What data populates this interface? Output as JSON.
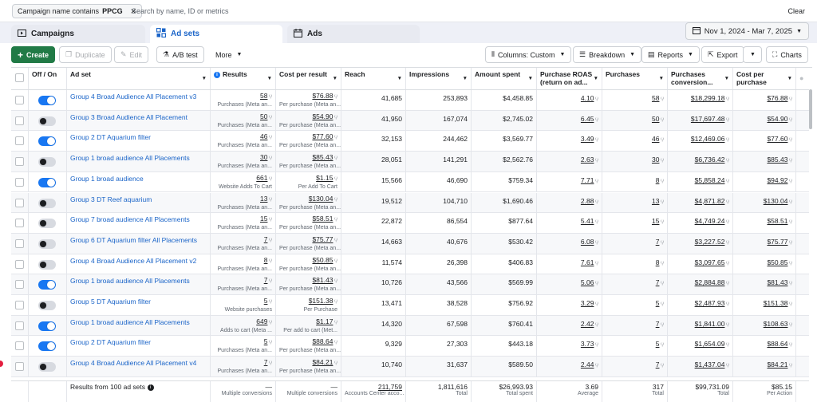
{
  "filter": {
    "chip_prefix": "Campaign name contains",
    "chip_value": "PPCG",
    "search_placeholder": "Search by name, ID or metrics",
    "clear_label": "Clear"
  },
  "tabs": [
    {
      "label": "Campaigns"
    },
    {
      "label": "Ad sets"
    },
    {
      "label": "Ads"
    }
  ],
  "date_range": "Nov 1, 2024 - Mar 7, 2025",
  "toolbar": {
    "create": "Create",
    "duplicate": "Duplicate",
    "edit": "Edit",
    "ab_test": "A/B test",
    "more": "More",
    "columns": "Columns: Custom",
    "breakdown": "Breakdown",
    "reports": "Reports",
    "export": "Export",
    "charts": "Charts"
  },
  "headers": {
    "off_on": "Off / On",
    "ad_set": "Ad set",
    "results": "Results",
    "cost_per_result": "Cost per result",
    "reach": "Reach",
    "impressions": "Impressions",
    "amount_spent": "Amount spent",
    "purchase_roas": "Purchase ROAS (return on ad...",
    "purchases": "Purchases",
    "purchases_conv": "Purchases conversion...",
    "cost_per_purchase": "Cost per purchase"
  },
  "rows": [
    {
      "on": true,
      "name": "Group 4 Broad Audience All Placement v3",
      "results": "58",
      "results_sub": "Purchases (Meta an...",
      "cpr": "$76.88",
      "cpr_sub": "Per purchase (Meta an...",
      "reach": "41,685",
      "impressions": "253,893",
      "amount": "$4,458.85",
      "roas": "4.10",
      "purchases": "58",
      "conv": "$18,299.18",
      "cpp": "$76.88"
    },
    {
      "on": false,
      "name": "Group 3 Broad Audience All Placement",
      "results": "50",
      "results_sub": "Purchases (Meta an...",
      "cpr": "$54.90",
      "cpr_sub": "Per purchase (Meta an...",
      "reach": "41,950",
      "impressions": "167,074",
      "amount": "$2,745.02",
      "roas": "6.45",
      "purchases": "50",
      "conv": "$17,697.48",
      "cpp": "$54.90"
    },
    {
      "on": true,
      "name": "Group 2 DT Aquarium filter",
      "results": "46",
      "results_sub": "Purchases (Meta an...",
      "cpr": "$77.60",
      "cpr_sub": "Per purchase (Meta an...",
      "reach": "32,153",
      "impressions": "244,462",
      "amount": "$3,569.77",
      "roas": "3.49",
      "purchases": "46",
      "conv": "$12,469.06",
      "cpp": "$77.60"
    },
    {
      "on": false,
      "name": "Group 1 broad audience All Placements",
      "results": "30",
      "results_sub": "Purchases (Meta an...",
      "cpr": "$85.43",
      "cpr_sub": "Per purchase (Meta an...",
      "reach": "28,051",
      "impressions": "141,291",
      "amount": "$2,562.76",
      "roas": "2.63",
      "purchases": "30",
      "conv": "$6,736.42",
      "cpp": "$85.43"
    },
    {
      "on": true,
      "name": "Group 1 broad audience",
      "results": "661",
      "results_sub": "Website Adds To Cart",
      "cpr": "$1.15",
      "cpr_sub": "Per Add To Cart",
      "reach": "15,566",
      "impressions": "46,690",
      "amount": "$759.34",
      "roas": "7.71",
      "purchases": "8",
      "conv": "$5,858.24",
      "cpp": "$94.92"
    },
    {
      "on": false,
      "name": "Group 3 DT Reef aquarium",
      "results": "13",
      "results_sub": "Purchases (Meta an...",
      "cpr": "$130.04",
      "cpr_sub": "Per purchase (Meta an...",
      "reach": "19,512",
      "impressions": "104,710",
      "amount": "$1,690.46",
      "roas": "2.88",
      "purchases": "13",
      "conv": "$4,871.82",
      "cpp": "$130.04"
    },
    {
      "on": false,
      "name": "Group 7 broad audience All Placements",
      "results": "15",
      "results_sub": "Purchases (Meta an...",
      "cpr": "$58.51",
      "cpr_sub": "Per purchase (Meta an...",
      "reach": "22,872",
      "impressions": "86,554",
      "amount": "$877.64",
      "roas": "5.41",
      "purchases": "15",
      "conv": "$4,749.24",
      "cpp": "$58.51"
    },
    {
      "on": false,
      "name": "Group 6 DT Aquarium filter All Placements",
      "results": "7",
      "results_sub": "Purchases (Meta an...",
      "cpr": "$75.77",
      "cpr_sub": "Per purchase (Meta an...",
      "reach": "14,663",
      "impressions": "40,676",
      "amount": "$530.42",
      "roas": "6.08",
      "purchases": "7",
      "conv": "$3,227.52",
      "cpp": "$75.77"
    },
    {
      "on": false,
      "name": "Group 4 Broad Audience All Placement v2",
      "results": "8",
      "results_sub": "Purchases (Meta an...",
      "cpr": "$50.85",
      "cpr_sub": "Per purchase (Meta an...",
      "reach": "11,574",
      "impressions": "26,398",
      "amount": "$406.83",
      "roas": "7.61",
      "purchases": "8",
      "conv": "$3,097.65",
      "cpp": "$50.85"
    },
    {
      "on": true,
      "name": "Group 1 broad audience All Placements",
      "results": "7",
      "results_sub": "Purchases (Meta an...",
      "cpr": "$81.43",
      "cpr_sub": "Per purchase (Meta an...",
      "reach": "10,726",
      "impressions": "43,566",
      "amount": "$569.99",
      "roas": "5.06",
      "purchases": "7",
      "conv": "$2,884.88",
      "cpp": "$81.43"
    },
    {
      "on": false,
      "name": "Group 5 DT Aquarium filter",
      "results": "5",
      "results_sub": "Website purchases",
      "cpr": "$151.38",
      "cpr_sub": "Per Purchase",
      "reach": "13,471",
      "impressions": "38,528",
      "amount": "$756.92",
      "roas": "3.29",
      "purchases": "5",
      "conv": "$2,487.93",
      "cpp": "$151.38"
    },
    {
      "on": true,
      "name": "Group 1 broad audience All Placements",
      "results": "649",
      "results_sub": "Adds to cart (Meta ...",
      "cpr": "$1.17",
      "cpr_sub": "Per add to cart (Met...",
      "reach": "14,320",
      "impressions": "67,598",
      "amount": "$760.41",
      "roas": "2.42",
      "purchases": "7",
      "conv": "$1,841.00",
      "cpp": "$108.63"
    },
    {
      "on": true,
      "name": "Group 2 DT Aquarium filter",
      "results": "5",
      "results_sub": "Purchases (Meta an...",
      "cpr": "$88.64",
      "cpr_sub": "Per purchase (Meta an...",
      "reach": "9,329",
      "impressions": "27,303",
      "amount": "$443.18",
      "roas": "3.73",
      "purchases": "5",
      "conv": "$1,654.09",
      "cpp": "$88.64"
    },
    {
      "on": false,
      "name": "Group 4 Broad Audience All Placement v4",
      "results": "7",
      "results_sub": "Purchases (Meta an...",
      "cpr": "$84.21",
      "cpr_sub": "Per purchase (Meta an...",
      "reach": "10,740",
      "impressions": "31,637",
      "amount": "$589.50",
      "roas": "2.44",
      "purchases": "7",
      "conv": "$1,437.04",
      "cpp": "$84.21"
    }
  ],
  "summary": {
    "label": "Results from 100 ad sets",
    "results": "—",
    "results_sub": "Multiple conversions",
    "cpr": "—",
    "cpr_sub": "Multiple conversions",
    "reach": "211,759",
    "reach_sub": "Accounts Center acco...",
    "impressions": "1,811,616",
    "impressions_sub": "Total",
    "amount": "$26,993.93",
    "amount_sub": "Total spent",
    "roas": "3.69",
    "roas_sub": "Average",
    "purchases": "317",
    "purchases_sub": "Total",
    "conv": "$99,731.09",
    "conv_sub": "Total",
    "cpp": "$85.15",
    "cpp_sub": "Per Action"
  },
  "colors": {
    "accent": "#1877f2",
    "create_green": "#217a46",
    "link": "#1a64c8"
  }
}
